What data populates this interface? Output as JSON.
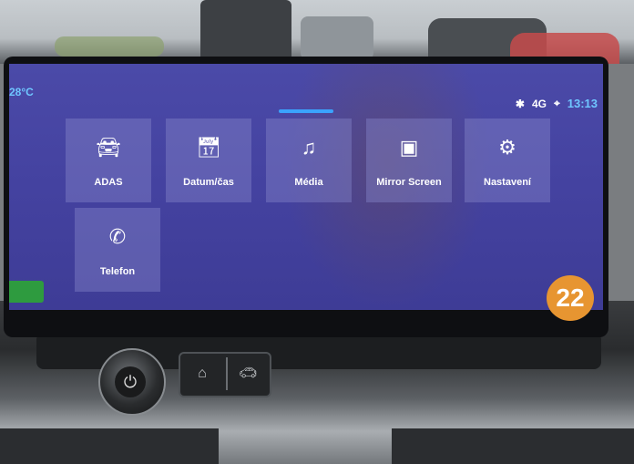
{
  "status_bar": {
    "temperature": "28°C",
    "bluetooth_icon": "bluetooth-icon",
    "network_label": "4G",
    "location_icon": "location-icon",
    "time": "13:13"
  },
  "tiles": [
    {
      "label": "ADAS",
      "icon": "car-icon"
    },
    {
      "label": "Datum/čas",
      "icon": "calendar-clock-icon"
    },
    {
      "label": "Média",
      "icon": "music-icon"
    },
    {
      "label": "Mirror Screen",
      "icon": "mirror-screen-icon"
    },
    {
      "label": "Nastavení",
      "icon": "gear-icon"
    },
    {
      "label": "Telefon",
      "icon": "phone-icon"
    }
  ],
  "badge": "22",
  "colors": {
    "screen_background": "#4442a0",
    "accent": "#3aa3ff",
    "badge": "#e79531"
  }
}
